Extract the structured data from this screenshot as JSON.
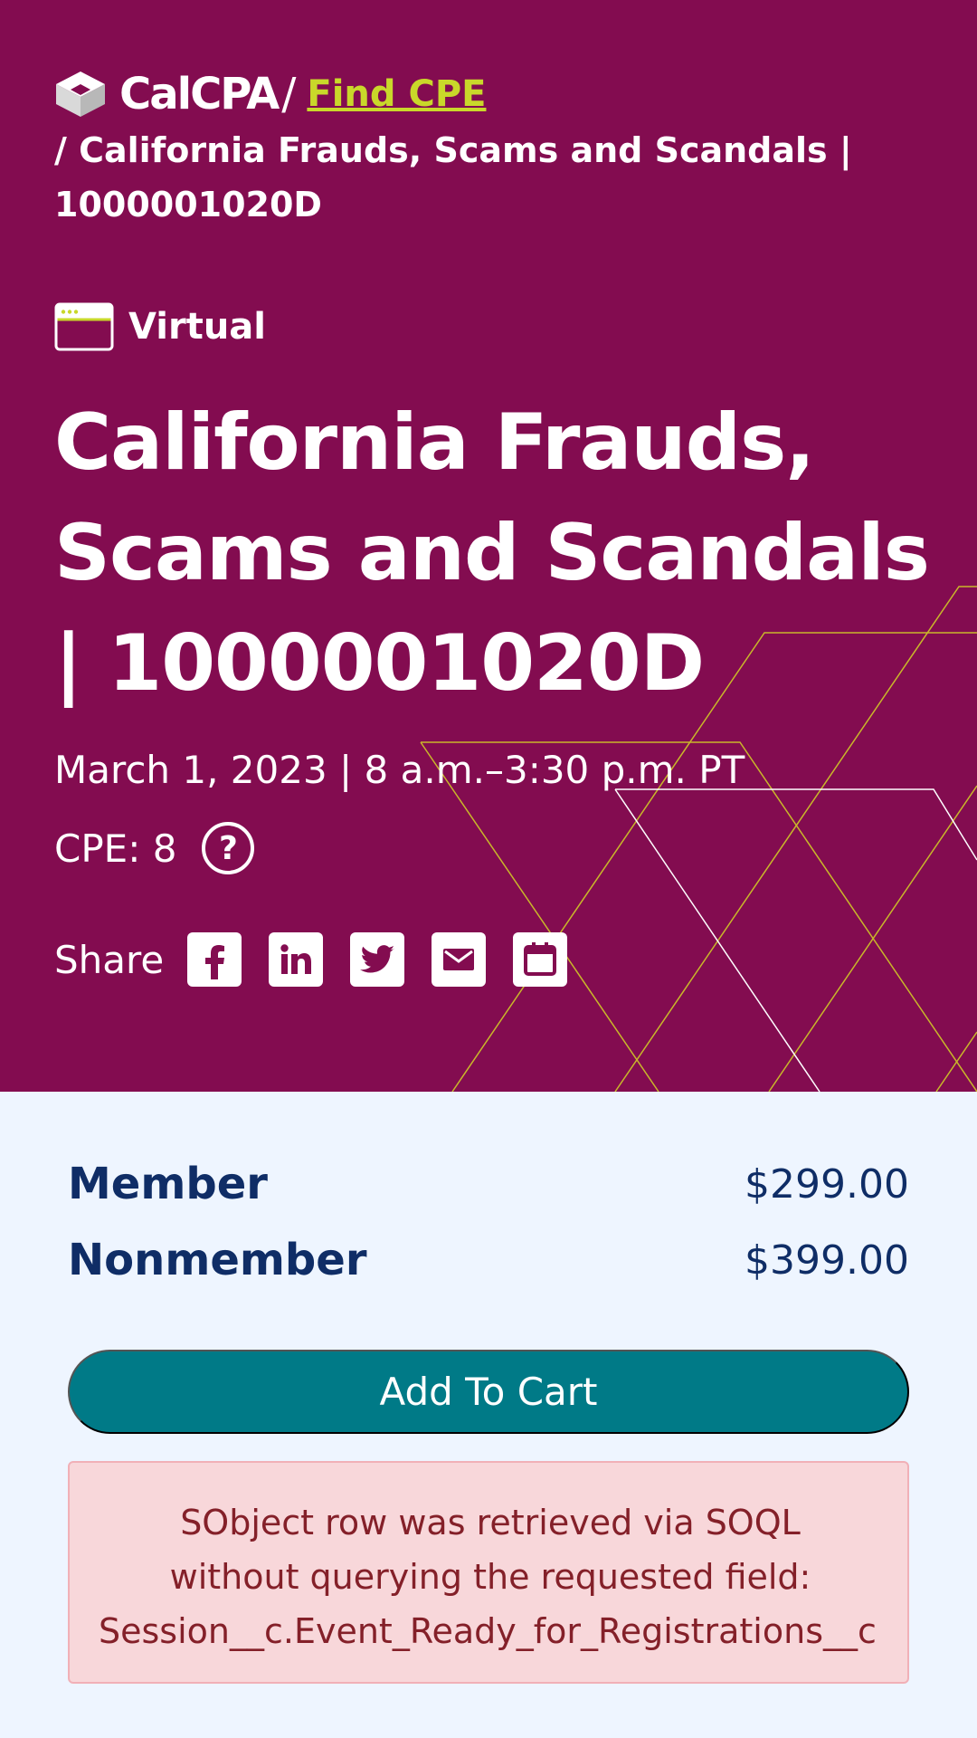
{
  "breadcrumb": {
    "logo_text": "CalCPA",
    "separator": "/",
    "link_label": "Find CPE",
    "current": "/ California Frauds, Scams and Scandals | 1000001020D"
  },
  "event": {
    "format_label": "Virtual",
    "title": "California Frauds, Scams and Scandals | 1000001020D",
    "date_time": "March 1, 2023 | 8 a.m.–3:30 p.m. PT",
    "cpe": "CPE: 8"
  },
  "share": {
    "label": "Share",
    "buttons": [
      "facebook-icon",
      "linkedin-icon",
      "twitter-icon",
      "email-icon",
      "calendar-icon"
    ]
  },
  "pricing": {
    "member_label": "Member",
    "member_price": "$299.00",
    "nonmember_label": "Nonmember",
    "nonmember_price": "$399.00"
  },
  "cart": {
    "button_label": "Add To Cart"
  },
  "error": {
    "line1": "SObject row was retrieved via SOQL",
    "line2": "without querying the requested field:",
    "line3": "Session__c.Event_Ready_for_Registrations__c"
  },
  "colors": {
    "hero_bg": "#830c50",
    "accent_link": "#c9d82a",
    "cart_button": "#007a87",
    "price_text": "#0f2d66",
    "error_bg": "#f8d7da",
    "error_text": "#842029",
    "page_bg": "#eef5ff"
  }
}
